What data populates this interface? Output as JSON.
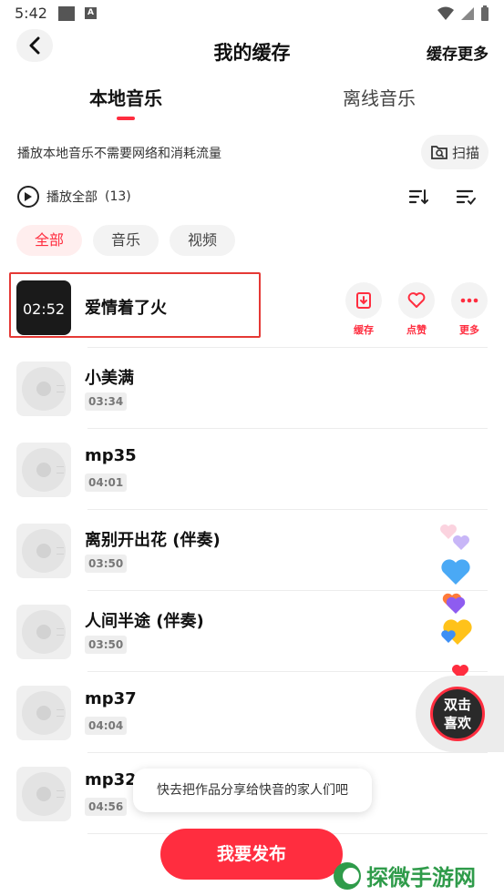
{
  "status_bar": {
    "time": "5:42",
    "a_badge": "A"
  },
  "header": {
    "title": "我的缓存",
    "cache_more": "缓存更多"
  },
  "tabs": [
    {
      "label": "本地音乐",
      "active": true
    },
    {
      "label": "离线音乐",
      "active": false
    }
  ],
  "notice": "播放本地音乐不需要网络和消耗流量",
  "scan": {
    "label": "扫描"
  },
  "play_all": {
    "label": "播放全部",
    "count": "(13)"
  },
  "filters": [
    {
      "label": "全部",
      "active": true
    },
    {
      "label": "音乐",
      "active": false
    },
    {
      "label": "视频",
      "active": false
    }
  ],
  "songs": [
    {
      "title": "爱情着了火",
      "cover_duration": "02:52",
      "duration": ""
    },
    {
      "title": "小美满",
      "duration": "03:34"
    },
    {
      "title": "mp35",
      "duration": "04:01"
    },
    {
      "title": "离别开出花 (伴奏)",
      "duration": "03:50"
    },
    {
      "title": "人间半途 (伴奏)",
      "duration": "03:50"
    },
    {
      "title": "mp37",
      "duration": "04:04"
    },
    {
      "title": "mp32",
      "duration": "04:56"
    }
  ],
  "actions": [
    {
      "label": "缓存",
      "icon": "download-icon"
    },
    {
      "label": "点赞",
      "icon": "heart-icon"
    },
    {
      "label": "更多",
      "icon": "more-icon"
    }
  ],
  "like_bubble": {
    "line1": "双击",
    "line2": "喜欢"
  },
  "tooltip": "快去把作品分享给快音的家人们吧",
  "publish": "我要发布",
  "watermark": "探微手游网",
  "colors": {
    "accent": "#ff2d3f",
    "chip_active_bg": "#ffeeee",
    "watermark_green": "#2f9b4a"
  }
}
